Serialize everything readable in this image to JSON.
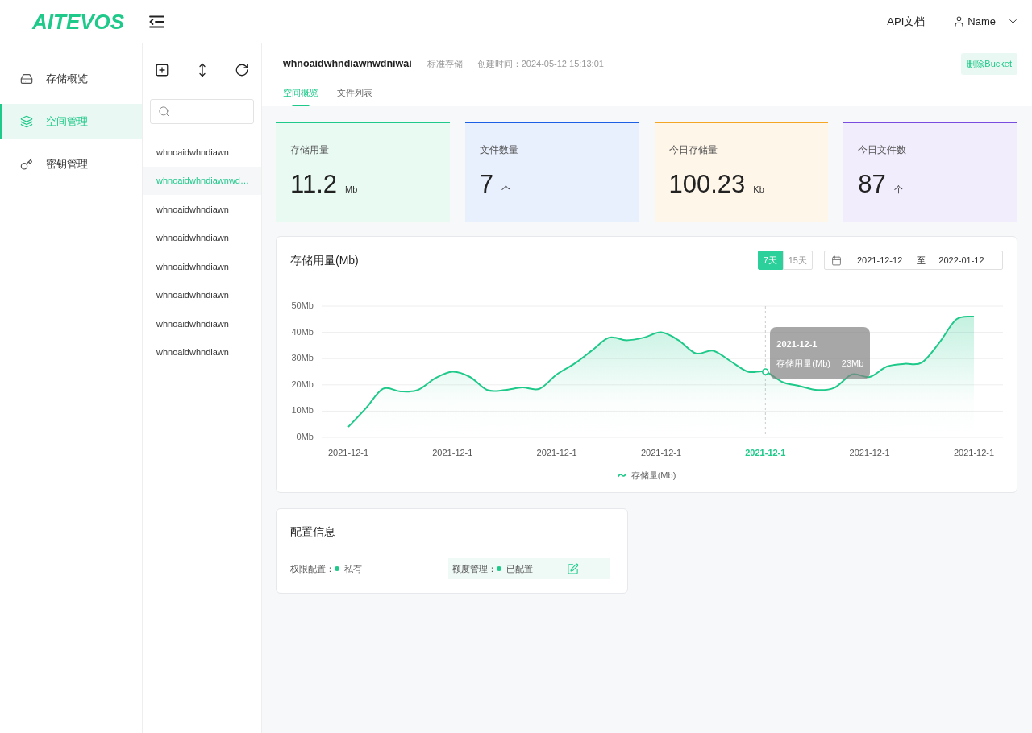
{
  "header": {
    "logo": "AITEVOS",
    "links": [
      "API文档"
    ],
    "user": "Name"
  },
  "nav": {
    "items": [
      {
        "label": "存储概览",
        "selected": false
      },
      {
        "label": "空间管理",
        "selected": true
      },
      {
        "label": "密钥管理",
        "selected": false
      }
    ]
  },
  "buckets": {
    "items": [
      {
        "name": "whnoaidwhndiawn",
        "selected": false
      },
      {
        "name": "whnoaidwhndiawnwd…",
        "selected": true
      },
      {
        "name": "whnoaidwhndiawn",
        "selected": false
      },
      {
        "name": "whnoaidwhndiawn",
        "selected": false
      },
      {
        "name": "whnoaidwhndiawn",
        "selected": false
      },
      {
        "name": "whnoaidwhndiawn",
        "selected": false
      },
      {
        "name": "whnoaidwhndiawn",
        "selected": false
      },
      {
        "name": "whnoaidwhndiawn",
        "selected": false
      }
    ]
  },
  "bucket": {
    "name": "whnoaidwhndiawnwdniwai",
    "storage_class": "标准存储",
    "created": "创建时间：2024-05-12 15:13:01",
    "delete_button": "删除Bucket"
  },
  "tabs": [
    {
      "label": "空间概览",
      "selected": true
    },
    {
      "label": "文件列表",
      "selected": false
    }
  ],
  "stats": [
    {
      "label": "存储用量",
      "value": "11.2",
      "unit": "Mb",
      "color": "#1ec98a"
    },
    {
      "label": "文件数量",
      "value": "7",
      "unit": "个",
      "color": "#1a5fe6"
    },
    {
      "label": "今日存储量",
      "value": "100.23",
      "unit": "Kb",
      "color": "#f5a623"
    },
    {
      "label": "今日文件数",
      "value": "87",
      "unit": "个",
      "color": "#7a4de0"
    }
  ],
  "usage_chart": {
    "ranges": [
      {
        "label": "7天",
        "selected": true
      },
      {
        "label": "15天",
        "selected": false
      }
    ],
    "date_range": {
      "start": "2021-12-12",
      "separator": "至",
      "end": "2022-01-12"
    },
    "chart_data": [
      {
        "type": "area",
        "title": "存储用量(Mb)",
        "categories": [
          "2021-12-1",
          null,
          null,
          null,
          null,
          null,
          "2021-12-1",
          null,
          null,
          null,
          null,
          null,
          "2021-12-1",
          null,
          null,
          null,
          null,
          null,
          "2021-12-1",
          null,
          null,
          null,
          null,
          null,
          "2021-12-1",
          null,
          null,
          null,
          null,
          null,
          "2021-12-1",
          null,
          null,
          null,
          null,
          null,
          "2021-12-1"
        ],
        "series": [
          {
            "name": "存储量(Mb)",
            "color": "#1ec98a",
            "values": [
              4,
              11,
              18.5,
              17.5,
              18,
              22.5,
              25,
              23,
              18,
              18,
              19,
              18.5,
              24,
              28,
              33,
              38,
              37,
              38,
              40,
              37,
              32,
              33,
              29,
              25,
              25,
              21,
              19.5,
              18,
              19,
              24,
              23,
              27,
              28,
              28.5,
              36,
              45,
              46
            ]
          }
        ],
        "ylim": [
          0,
          50
        ],
        "yticks": [
          {
            "value": 0,
            "label": "0Mb"
          },
          {
            "value": 10,
            "label": "10Mb"
          },
          {
            "value": 20,
            "label": "20Mb"
          },
          {
            "value": 30,
            "label": "30Mb"
          },
          {
            "value": 40,
            "label": "40Mb"
          },
          {
            "value": 50,
            "label": "50Mb"
          }
        ],
        "grid": true,
        "legend": "bottom"
      }
    ],
    "tooltip": {
      "title": "2021-12-1",
      "label": "存储用量(Mb)",
      "value": "23Mb"
    }
  },
  "config": {
    "title": "配置信息",
    "items": [
      {
        "label": "权限配置：",
        "value": "私有",
        "color": "#1ec98a",
        "editable": false
      },
      {
        "label": "额度管理：",
        "value": "已配置",
        "color": "#1ec98a",
        "editable": true
      }
    ]
  }
}
